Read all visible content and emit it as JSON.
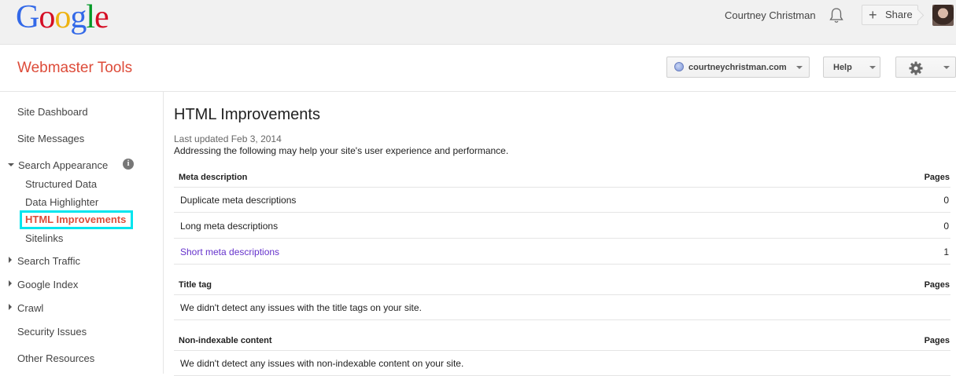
{
  "topbar": {
    "logo_letters": [
      "G",
      "o",
      "o",
      "g",
      "l",
      "e"
    ],
    "logo_colors": [
      "#3369e8",
      "#d50f25",
      "#eeb211",
      "#3369e8",
      "#009925",
      "#d50f25"
    ],
    "user_name": "Courtney Christman",
    "share_label": "Share",
    "share_icon": "+"
  },
  "header": {
    "app_title": "Webmaster Tools",
    "site_selected": "courtneychristman.com",
    "help_label": "Help"
  },
  "sidebar": {
    "site_dashboard": "Site Dashboard",
    "site_messages": "Site Messages",
    "search_appearance": "Search Appearance",
    "info_icon": "i",
    "structured_data": "Structured Data",
    "data_highlighter": "Data Highlighter",
    "html_improvements": "HTML Improvements",
    "sitelinks": "Sitelinks",
    "search_traffic": "Search Traffic",
    "google_index": "Google Index",
    "crawl": "Crawl",
    "security_issues": "Security Issues",
    "other_resources": "Other Resources"
  },
  "main": {
    "title": "HTML Improvements",
    "last_updated": "Last updated Feb 3, 2014",
    "description": "Addressing the following may help your site's user experience and performance.",
    "pages_header": "Pages",
    "meta": {
      "header": "Meta description",
      "rows": [
        {
          "label": "Duplicate meta descriptions",
          "pages": "0"
        },
        {
          "label": "Long meta descriptions",
          "pages": "0"
        },
        {
          "label": "Short meta descriptions",
          "pages": "1"
        }
      ]
    },
    "title_tag": {
      "header": "Title tag",
      "message": "We didn't detect any issues with the title tags on your site."
    },
    "non_indexable": {
      "header": "Non-indexable content",
      "message": "We didn't detect any issues with non-indexable content on your site."
    }
  },
  "colors": {
    "accent_red": "#dd4b39",
    "highlight_cyan": "#00e5ee",
    "link_purple": "#6633cc"
  }
}
